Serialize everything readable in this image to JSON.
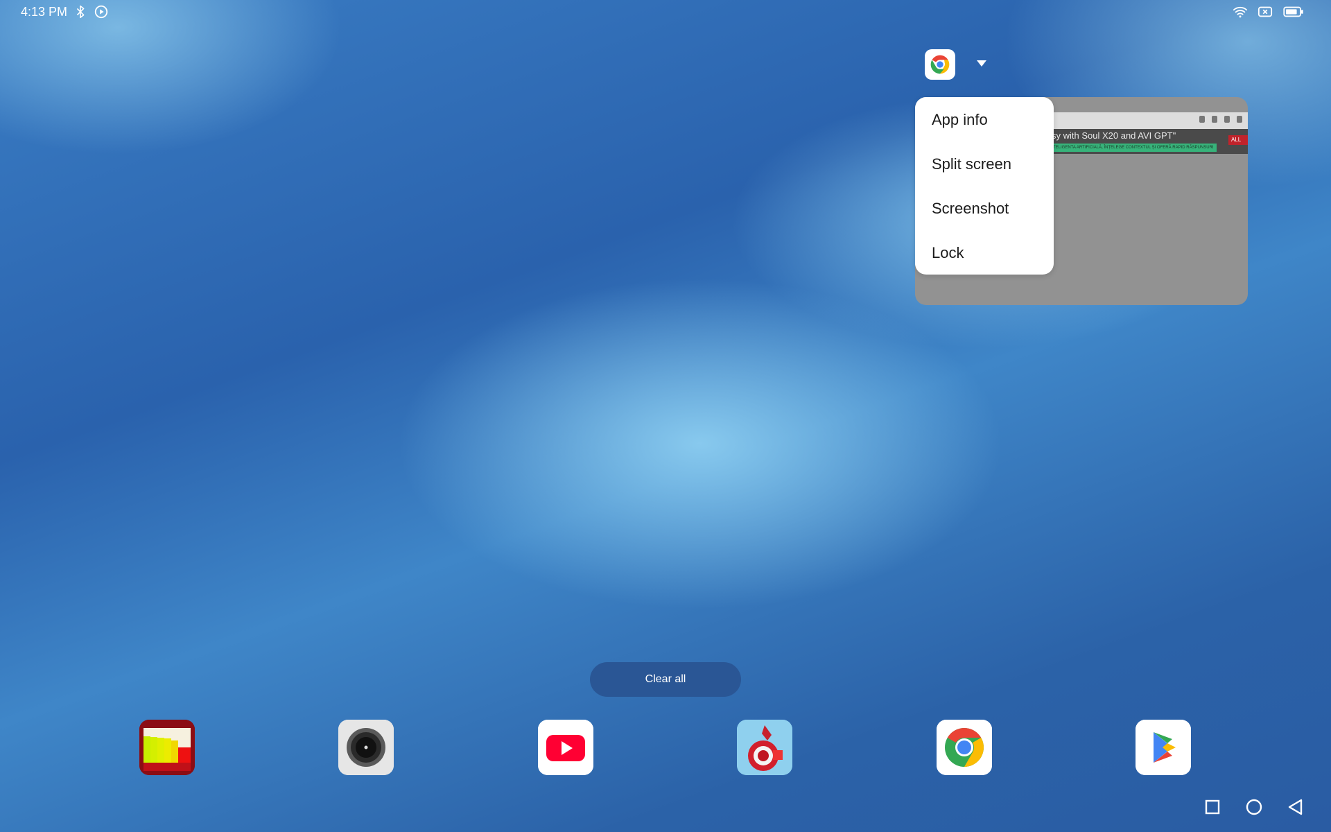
{
  "status_bar": {
    "time": "4:13 PM",
    "left_icons": [
      "bluetooth-icon",
      "media-play-icon"
    ],
    "right_icons": [
      "wifi-icon",
      "no-sim-icon",
      "battery-icon"
    ]
  },
  "recents": {
    "task": {
      "app_icon": "chrome-icon",
      "expand_icon": "chevron-down-icon",
      "thumbnail": {
        "headline": "sy with Soul X20 and AVI GPT\"",
        "subline": "TELIGENTA ARTIFICIALĂ, ÎNȚELEGE CONTEXTUL ȘI OFERĂ RAPID RĂSPUNSURI",
        "badge": "ALL"
      },
      "menu": [
        {
          "label": "App info"
        },
        {
          "label": "Split screen"
        },
        {
          "label": "Screenshot"
        },
        {
          "label": "Lock"
        }
      ]
    },
    "clear_all_label": "Clear all"
  },
  "dock": {
    "apps": [
      {
        "name": "signal-meter-app-icon"
      },
      {
        "name": "camera-app-icon"
      },
      {
        "name": "youtube-app-icon"
      },
      {
        "name": "game-app-icon"
      },
      {
        "name": "chrome-app-icon"
      },
      {
        "name": "play-store-app-icon"
      }
    ]
  },
  "nav_bar": {
    "buttons": [
      "recents-icon",
      "home-icon",
      "back-icon"
    ]
  },
  "colors": {
    "menu_bg": "#ffffff",
    "clear_all_bg": "#2a5695",
    "chrome_red": "#ea4335",
    "chrome_yellow": "#fbbc04",
    "chrome_green": "#34a853",
    "chrome_blue": "#4285f4",
    "youtube_red": "#ff0033"
  }
}
